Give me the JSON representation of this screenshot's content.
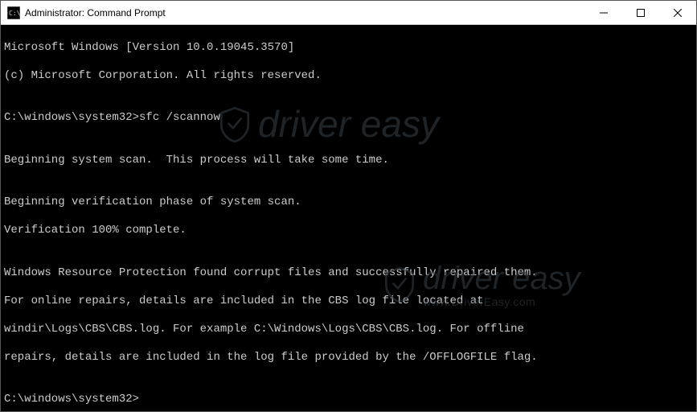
{
  "titlebar": {
    "title": "Administrator: Command Prompt"
  },
  "terminal": {
    "lines": {
      "l0": "Microsoft Windows [Version 10.0.19045.3570]",
      "l1": "(c) Microsoft Corporation. All rights reserved.",
      "l2": "",
      "l3_prompt": "C:\\windows\\system32>",
      "l3_cmd": "sfc /scannow",
      "l4": "",
      "l5": "Beginning system scan.  This process will take some time.",
      "l6": "",
      "l7": "Beginning verification phase of system scan.",
      "l8": "Verification 100% complete.",
      "l9": "",
      "l10": "Windows Resource Protection found corrupt files and successfully repaired them.",
      "l11": "For online repairs, details are included in the CBS log file located at",
      "l12": "windir\\Logs\\CBS\\CBS.log. For example C:\\Windows\\Logs\\CBS\\CBS.log. For offline",
      "l13": "repairs, details are included in the log file provided by the /OFFLOGFILE flag.",
      "l14": "",
      "l15_prompt": "C:\\windows\\system32>"
    }
  },
  "watermark": {
    "text1": "driver easy",
    "text2": "driver easy",
    "url": "www.DriverEasy.com"
  }
}
